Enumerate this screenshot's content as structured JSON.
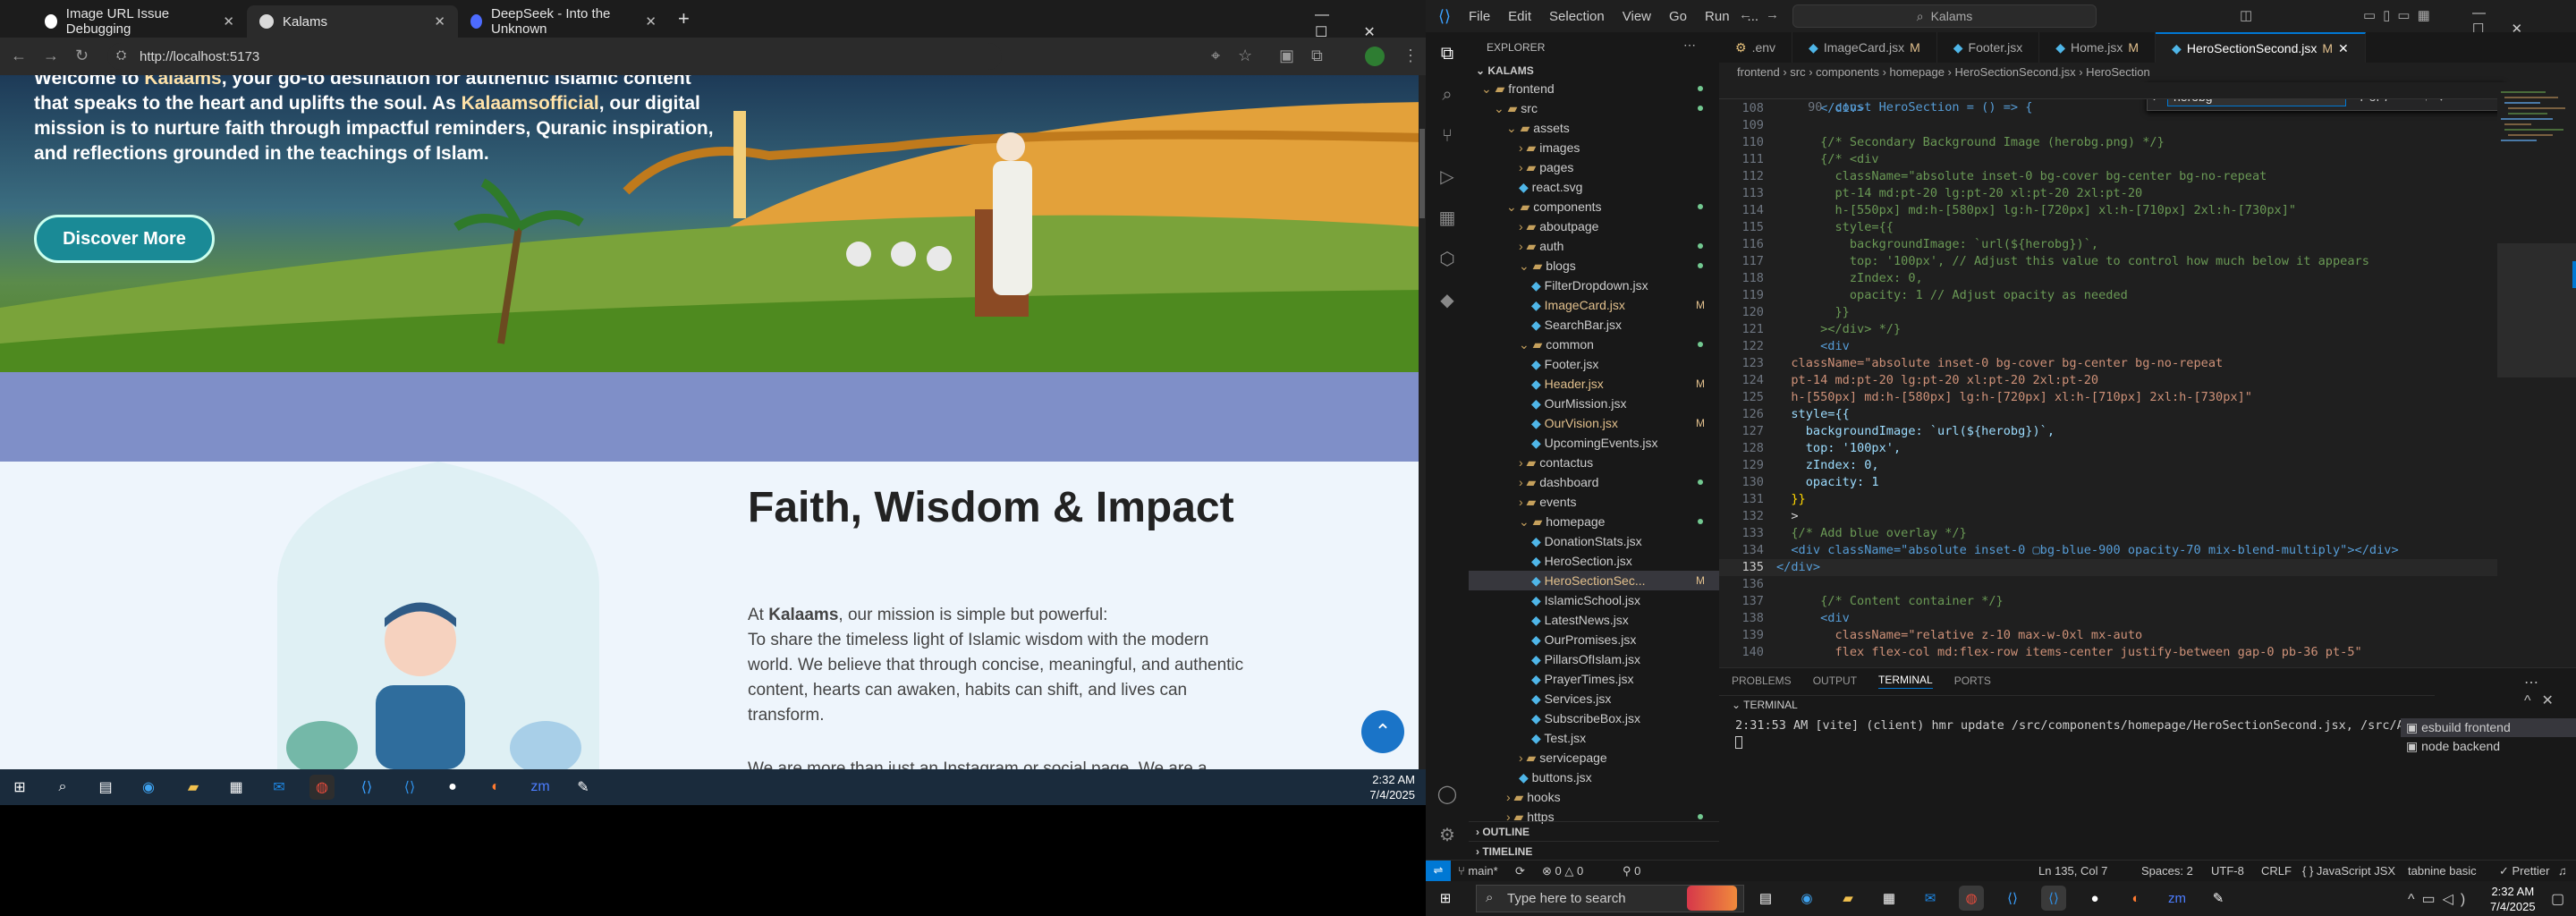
{
  "browser": {
    "tabs": [
      {
        "title": "Image URL Issue Debugging",
        "active": false
      },
      {
        "title": "Kalams",
        "active": true
      },
      {
        "title": "DeepSeek - Into the Unknown",
        "active": false
      }
    ],
    "new_tab": "+",
    "url": "http://localhost:5173",
    "window_controls": [
      "—",
      "☐",
      "✕"
    ]
  },
  "site": {
    "hero_text_parts": [
      {
        "text": "Welcome to ",
        "bold": true
      },
      {
        "text": "Kalaams",
        "strong": true
      },
      {
        "text": ", your go-to destination for authentic Islamic content that speaks to the heart and uplifts the soul. As ",
        "bold": true
      },
      {
        "text": "Kalaamsofficial",
        "strong": true
      },
      {
        "text": ", our digital mission is to nurture faith through impactful reminders, Quranic inspiration, and reflections grounded in the teachings of Islam.",
        "bold": true
      }
    ],
    "discover_button": "Discover More",
    "faith_title": "Faith, Wisdom & Impact",
    "mission_prefix": "At ",
    "mission_brand": "Kalaams",
    "mission_rest": ", our mission is simple but powerful:",
    "mission_body": "To share the timeless light of Islamic wisdom with the modern world. We believe that through concise, meaningful, and authentic content, hearts can awaken, habits can shift, and lives can transform.",
    "cut_line": "We are more than just an Instagram or social page. We are a"
  },
  "left_taskbar": {
    "time": "2:32 AM",
    "date": "7/4/2025"
  },
  "vscode": {
    "menu": [
      "File",
      "Edit",
      "Selection",
      "View",
      "Go",
      "Run",
      "..."
    ],
    "search": "Kalams",
    "explorer_title": "EXPLORER",
    "root": "KALAMS",
    "tree": [
      {
        "label": "frontend",
        "depth": 0,
        "type": "folder-open",
        "dot": true
      },
      {
        "label": "src",
        "depth": 1,
        "type": "folder-open",
        "dot": true
      },
      {
        "label": "assets",
        "depth": 2,
        "type": "folder-open"
      },
      {
        "label": "images",
        "depth": 3,
        "type": "folder"
      },
      {
        "label": "pages",
        "depth": 3,
        "type": "folder"
      },
      {
        "label": "react.svg",
        "depth": 3,
        "type": "file"
      },
      {
        "label": "components",
        "depth": 2,
        "type": "folder-open",
        "dot": true
      },
      {
        "label": "aboutpage",
        "depth": 3,
        "type": "folder"
      },
      {
        "label": "auth",
        "depth": 3,
        "type": "folder",
        "dot": true
      },
      {
        "label": "blogs",
        "depth": 3,
        "type": "folder-open",
        "dot": true
      },
      {
        "label": "FilterDropdown.jsx",
        "depth": 4,
        "type": "file"
      },
      {
        "label": "ImageCard.jsx",
        "depth": 4,
        "type": "file",
        "mod": "M"
      },
      {
        "label": "SearchBar.jsx",
        "depth": 4,
        "type": "file"
      },
      {
        "label": "common",
        "depth": 3,
        "type": "folder-open",
        "dot": true
      },
      {
        "label": "Footer.jsx",
        "depth": 4,
        "type": "file"
      },
      {
        "label": "Header.jsx",
        "depth": 4,
        "type": "file",
        "mod": "M"
      },
      {
        "label": "OurMission.jsx",
        "depth": 4,
        "type": "file"
      },
      {
        "label": "OurVision.jsx",
        "depth": 4,
        "type": "file",
        "mod": "M"
      },
      {
        "label": "UpcomingEvents.jsx",
        "depth": 4,
        "type": "file"
      },
      {
        "label": "contactus",
        "depth": 3,
        "type": "folder"
      },
      {
        "label": "dashboard",
        "depth": 3,
        "type": "folder",
        "dot": true
      },
      {
        "label": "events",
        "depth": 3,
        "type": "folder"
      },
      {
        "label": "homepage",
        "depth": 3,
        "type": "folder-open",
        "dot": true
      },
      {
        "label": "DonationStats.jsx",
        "depth": 4,
        "type": "file"
      },
      {
        "label": "HeroSection.jsx",
        "depth": 4,
        "type": "file"
      },
      {
        "label": "HeroSectionSec...",
        "depth": 4,
        "type": "file",
        "mod": "M",
        "selected": true
      },
      {
        "label": "IslamicSchool.jsx",
        "depth": 4,
        "type": "file"
      },
      {
        "label": "LatestNews.jsx",
        "depth": 4,
        "type": "file"
      },
      {
        "label": "OurPromises.jsx",
        "depth": 4,
        "type": "file"
      },
      {
        "label": "PillarsOfIslam.jsx",
        "depth": 4,
        "type": "file"
      },
      {
        "label": "PrayerTimes.jsx",
        "depth": 4,
        "type": "file"
      },
      {
        "label": "Services.jsx",
        "depth": 4,
        "type": "file"
      },
      {
        "label": "SubscribeBox.jsx",
        "depth": 4,
        "type": "file"
      },
      {
        "label": "Test.jsx",
        "depth": 4,
        "type": "file"
      },
      {
        "label": "servicepage",
        "depth": 3,
        "type": "folder"
      },
      {
        "label": "buttons.jsx",
        "depth": 3,
        "type": "file"
      },
      {
        "label": "hooks",
        "depth": 2,
        "type": "folder"
      },
      {
        "label": "https",
        "depth": 2,
        "type": "folder",
        "dot": true
      }
    ],
    "outline": "OUTLINE",
    "timeline": "TIMELINE",
    "editor_tabs": [
      {
        "label": ".env",
        "mod": ""
      },
      {
        "label": "ImageCard.jsx",
        "mod": "M"
      },
      {
        "label": "Footer.jsx",
        "mod": ""
      },
      {
        "label": "Home.jsx",
        "mod": "M"
      },
      {
        "label": "HeroSectionSecond.jsx",
        "mod": "M",
        "active": true
      }
    ],
    "breadcrumb": "frontend  ›  src  ›  components  ›  homepage  ›  HeroSectionSecond.jsx  ›  HeroSection",
    "sticky_line": {
      "n": 90,
      "text": "const HeroSection = () => {"
    },
    "code_lines": [
      {
        "n": 108,
        "t": "      </div>",
        "k": "tag"
      },
      {
        "n": 109,
        "t": "",
        "k": "txt"
      },
      {
        "n": 110,
        "t": "      {/* Secondary Background Image (herobg.png) */}",
        "k": "com"
      },
      {
        "n": 111,
        "t": "      {/* <div",
        "k": "com"
      },
      {
        "n": 112,
        "t": "        className=\"absolute inset-0 bg-cover bg-center bg-no-repeat",
        "k": "com"
      },
      {
        "n": 113,
        "t": "        pt-14 md:pt-20 lg:pt-20 xl:pt-20 2xl:pt-20",
        "k": "com"
      },
      {
        "n": 114,
        "t": "        h-[550px] md:h-[580px] lg:h-[720px] xl:h-[710px] 2xl:h-[730px]\"",
        "k": "com"
      },
      {
        "n": 115,
        "t": "        style={{",
        "k": "com"
      },
      {
        "n": 116,
        "t": "          backgroundImage: `url(${herobg})`,",
        "k": "com"
      },
      {
        "n": 117,
        "t": "          top: '100px', // Adjust this value to control how much below it appears",
        "k": "com"
      },
      {
        "n": 118,
        "t": "          zIndex: 0,",
        "k": "com"
      },
      {
        "n": 119,
        "t": "          opacity: 1 // Adjust opacity as needed",
        "k": "com"
      },
      {
        "n": 120,
        "t": "        }}",
        "k": "com"
      },
      {
        "n": 121,
        "t": "      ></div> */}",
        "k": "com"
      },
      {
        "n": 122,
        "t": "      <div",
        "k": "tag"
      },
      {
        "n": 123,
        "t": "  className=\"absolute inset-0 bg-cover bg-center bg-no-repeat",
        "k": "str"
      },
      {
        "n": 124,
        "t": "  pt-14 md:pt-20 lg:pt-20 xl:pt-20 2xl:pt-20",
        "k": "str"
      },
      {
        "n": 125,
        "t": "  h-[550px] md:h-[580px] lg:h-[720px] xl:h-[710px] 2xl:h-[730px]\"",
        "k": "str"
      },
      {
        "n": 126,
        "t": "  style={{",
        "k": "attr"
      },
      {
        "n": 127,
        "t": "    backgroundImage: `url(${herobg})`,",
        "k": "prop"
      },
      {
        "n": 128,
        "t": "    top: '100px',",
        "k": "prop"
      },
      {
        "n": 129,
        "t": "    zIndex: 0,",
        "k": "prop"
      },
      {
        "n": 130,
        "t": "    opacity: 1",
        "k": "prop"
      },
      {
        "n": 131,
        "t": "  }}",
        "k": "br"
      },
      {
        "n": 132,
        "t": "  >",
        "k": "txt"
      },
      {
        "n": 133,
        "t": "  {/* Add blue overlay */}",
        "k": "com"
      },
      {
        "n": 134,
        "t": "  <div className=\"absolute inset-0 ▢bg-blue-900 opacity-70 mix-blend-multiply\"></div>",
        "k": "tag"
      },
      {
        "n": 135,
        "t": "</div>",
        "k": "tag",
        "cur": true
      },
      {
        "n": 136,
        "t": "",
        "k": "txt"
      },
      {
        "n": 137,
        "t": "      {/* Content container */}",
        "k": "com"
      },
      {
        "n": 138,
        "t": "      <div",
        "k": "tag"
      },
      {
        "n": 139,
        "t": "        className=\"relative z-10 max-w-0xl mx-auto",
        "k": "str"
      },
      {
        "n": 140,
        "t": "        flex flex-col md:flex-row items-center justify-between gap-0 pb-36 pt-5\"",
        "k": "str"
      }
    ],
    "find": {
      "query": "herobg",
      "options": "Aa  ab  .*",
      "count": "7 of 7"
    },
    "panel_tabs": [
      "PROBLEMS",
      "OUTPUT",
      "TERMINAL",
      "PORTS"
    ],
    "terminal_label": "TERMINAL",
    "terminal_line": "2:31:53 AM [vite] (client) hmr update /src/components/homepage/HeroSectionSecond.jsx, /src/App.css (x3)",
    "terminal_instances": [
      "esbuild  frontend",
      "node  backend"
    ],
    "status": {
      "branch": "main*",
      "sync": "⟳",
      "errors": "⊗ 0 △ 0",
      "ports": "⚲ 0",
      "position": "Ln 135, Col 7",
      "spaces": "Spaces: 2",
      "encoding": "UTF-8",
      "eol": "CRLF",
      "lang": "{ } JavaScript JSX",
      "tabnine": "tabnine basic",
      "prettier": "✓ Prettier"
    }
  },
  "right_taskbar": {
    "search_placeholder": "Type here to search",
    "time": "2:32 AM",
    "date": "7/4/2025"
  },
  "colors": {
    "vscode_accent": "#0078d4",
    "modified": "#e2c08d",
    "hero_button": "#1a8a96",
    "scroll_top": "#1a74c8"
  }
}
